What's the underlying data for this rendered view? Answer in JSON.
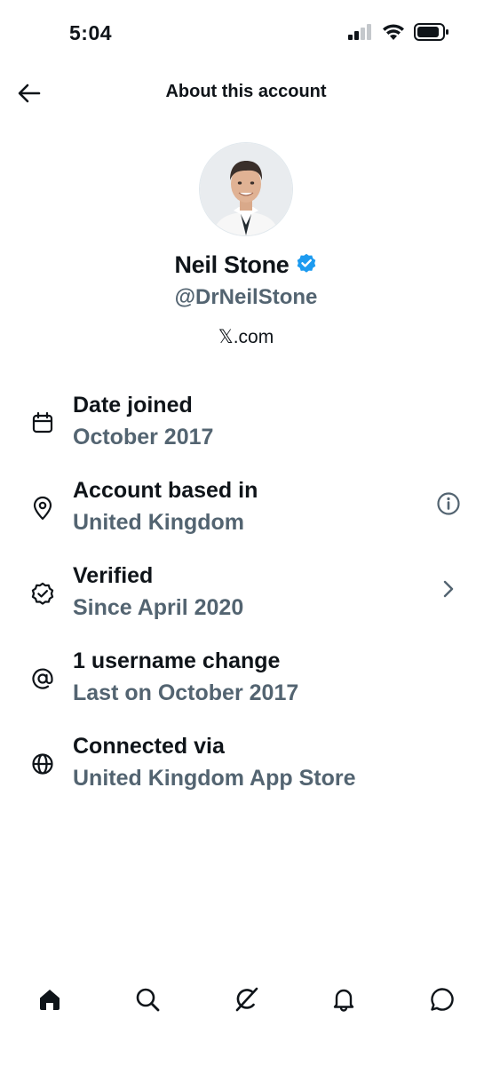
{
  "status_bar": {
    "time": "5:04"
  },
  "header": {
    "title": "About this account",
    "back_icon": "back-arrow-icon"
  },
  "profile": {
    "name": "Neil Stone",
    "handle": "@DrNeilStone",
    "source": "𝕏.com",
    "verified_badge": "verified-badge-icon",
    "badge_color": "#1d9bf0"
  },
  "info_rows": [
    {
      "icon": "calendar-icon",
      "title": "Date joined",
      "value": "October 2017"
    },
    {
      "icon": "location-pin-icon",
      "title": "Account based in",
      "value": "United Kingdom",
      "action": "info-icon"
    },
    {
      "icon": "verified-badge-outline-icon",
      "title": "Verified",
      "value": "Since April 2020",
      "action": "chevron-right-icon"
    },
    {
      "icon": "at-sign-icon",
      "title": "1 username change",
      "value": "Last on October 2017"
    },
    {
      "icon": "globe-icon",
      "title": "Connected via",
      "value": "United Kingdom App Store"
    }
  ],
  "bottom_nav": [
    {
      "name": "home",
      "icon": "home-icon",
      "active": true
    },
    {
      "name": "search",
      "icon": "search-icon"
    },
    {
      "name": "grok",
      "icon": "grok-icon"
    },
    {
      "name": "notifications",
      "icon": "bell-icon"
    },
    {
      "name": "messages",
      "icon": "message-bubble-icon"
    }
  ],
  "colors": {
    "text_primary": "#0f1419",
    "text_secondary": "#536471",
    "accent": "#1d9bf0",
    "background": "#ffffff"
  }
}
